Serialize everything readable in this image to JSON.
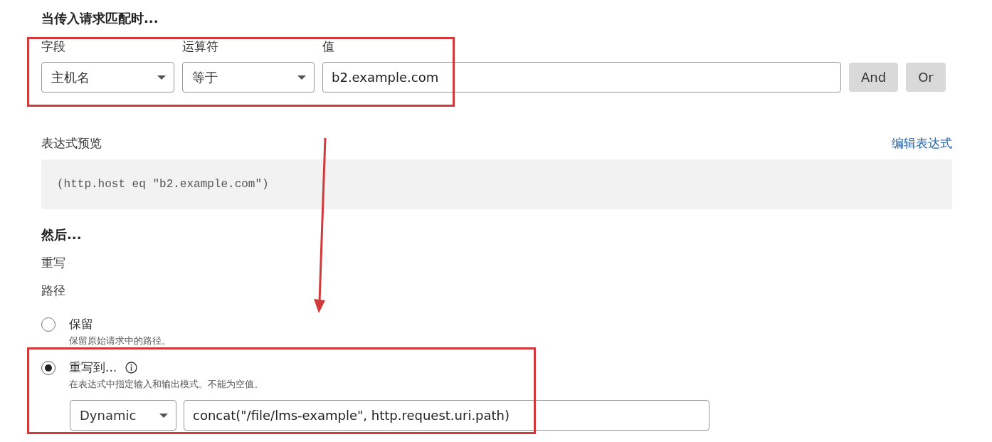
{
  "heading": "当传入请求匹配时...",
  "condition": {
    "fields": [
      {
        "label": "字段",
        "kind": "select",
        "value": "主机名"
      },
      {
        "label": "运算符",
        "kind": "select",
        "value": "等于"
      },
      {
        "label": "值",
        "kind": "text",
        "value": "b2.example.com"
      }
    ],
    "buttons": [
      "And",
      "Or"
    ]
  },
  "preview": {
    "label": "表达式预览",
    "link": "编辑表达式",
    "code": "(http.host eq \"b2.example.com\")"
  },
  "then": {
    "heading": "然后...",
    "action": "重写",
    "path_label": "路径",
    "options": [
      {
        "label": "保留",
        "description": "保留原始请求中的路径。",
        "selected": false,
        "info": false
      },
      {
        "label": "重写到...",
        "description": "在表达式中指定输入和输出模式。不能为空值。",
        "selected": true,
        "info": true
      }
    ],
    "rewrite": {
      "mode": "Dynamic",
      "expression": "concat(\"/file/lms-example\", http.request.uri.path)"
    }
  }
}
